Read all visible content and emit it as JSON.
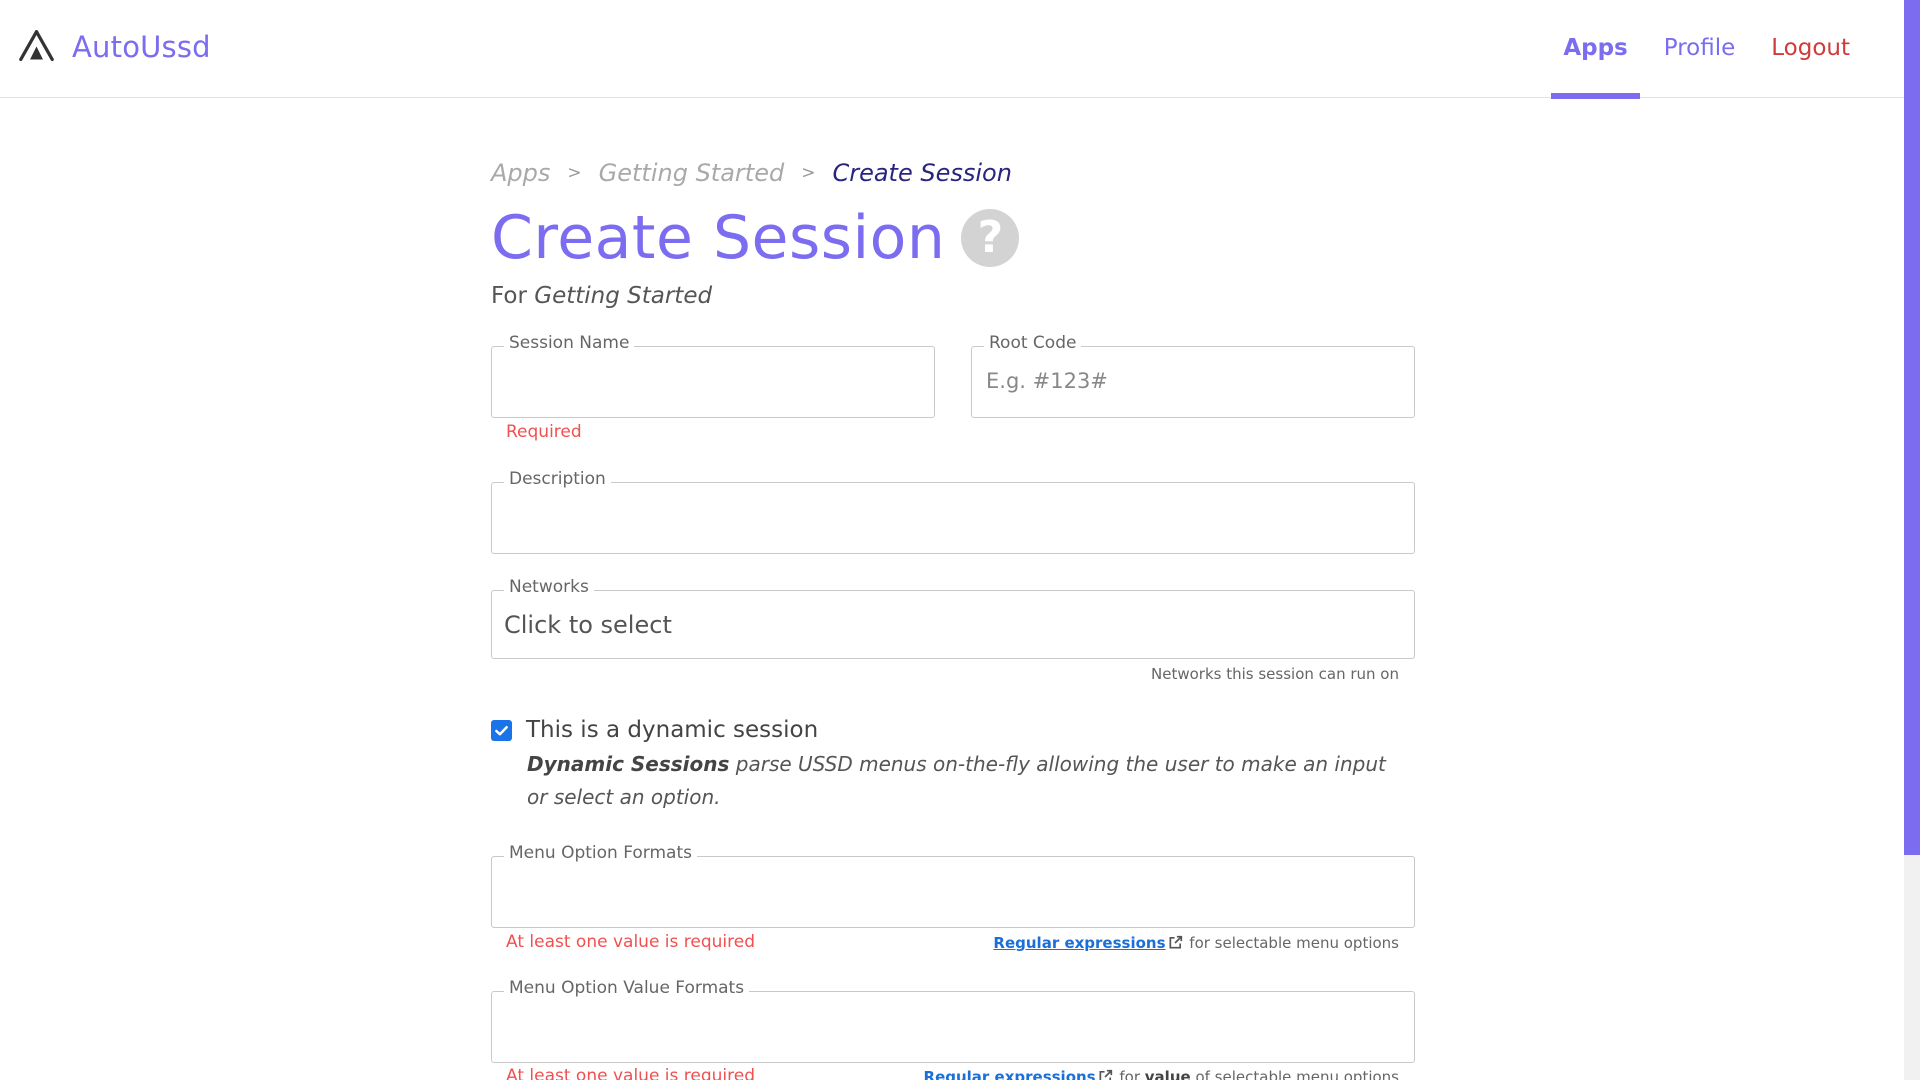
{
  "brand": {
    "name": "AutoUssd",
    "logo_icon": "tent-logo-icon"
  },
  "nav": {
    "apps": "Apps",
    "profile": "Profile",
    "logout": "Logout"
  },
  "breadcrumb": {
    "items": [
      "Apps",
      "Getting Started",
      "Create Session"
    ],
    "separator": ">"
  },
  "page": {
    "title": "Create Session",
    "help_icon": "question-circle-icon",
    "subtitle_prefix": "For",
    "subtitle_app": "Getting Started"
  },
  "form": {
    "session_name": {
      "label": "Session Name",
      "value": "",
      "placeholder": "",
      "error": "Required"
    },
    "root_code": {
      "label": "Root Code",
      "value": "",
      "placeholder": "E.g. #123#"
    },
    "description": {
      "label": "Description",
      "value": "",
      "placeholder": ""
    },
    "networks": {
      "label": "Networks",
      "value": "Click to select",
      "hint": "Networks this session can run on"
    },
    "dynamic": {
      "checked": true,
      "label": "This is a dynamic session",
      "desc_bold": "Dynamic Sessions",
      "desc_rest": " parse USSD menus on-the-fly allowing the user to make an input or select an option."
    },
    "menu_option_formats": {
      "label": "Menu Option Formats",
      "error": "At least one value is required",
      "hint_link": "Regular expressions",
      "hint_text": " for selectable menu options"
    },
    "menu_option_value_formats": {
      "label": "Menu Option Value Formats",
      "error": "At least one value is required",
      "hint_link": "Regular expressions",
      "hint_mid": " for ",
      "hint_bold": "value",
      "hint_rest": " of selectable menu options"
    }
  },
  "colors": {
    "accent": "#7b6cf0",
    "error": "#f05050",
    "logout": "#d13a3a",
    "link": "#1a6fd8",
    "checkbox": "#1a73e8"
  }
}
